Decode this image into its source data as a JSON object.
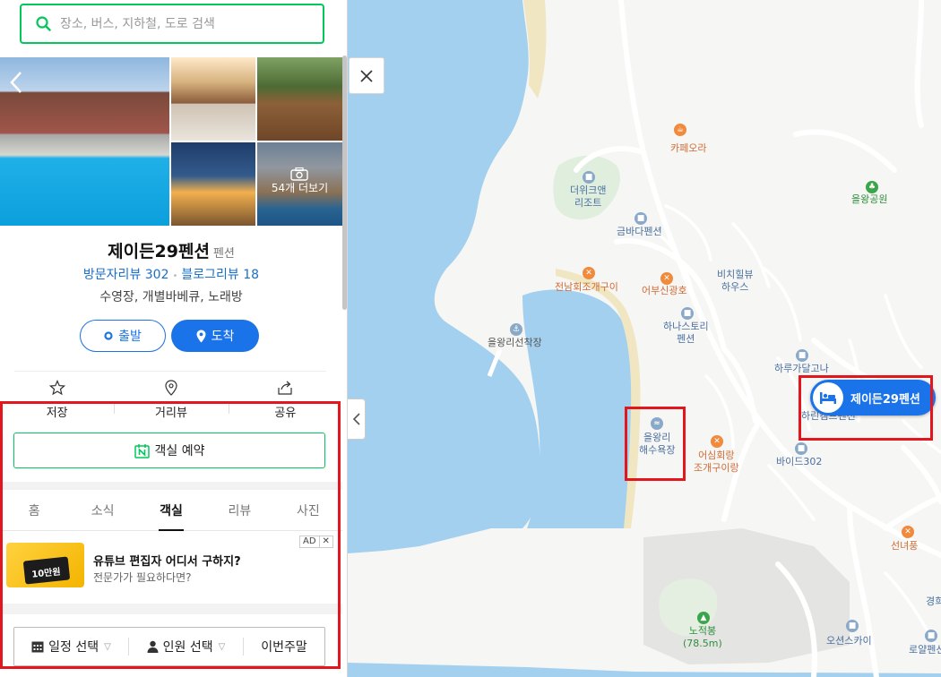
{
  "search": {
    "placeholder": "장소, 버스, 지하철, 도로 검색"
  },
  "photos": {
    "more_label": "54개 더보기"
  },
  "place": {
    "name": "제이든29펜션",
    "category": "펜션",
    "visitor_reviews": "방문자리뷰 302",
    "blog_reviews": "블로그리뷰 18",
    "amenities": "수영장, 개별바베큐, 노래방"
  },
  "buttons": {
    "depart": "출발",
    "arrive": "도착",
    "book": "객실 예약"
  },
  "actions": [
    {
      "label": "저장",
      "icon": "star-icon"
    },
    {
      "label": "거리뷰",
      "icon": "location-pin-icon"
    },
    {
      "label": "공유",
      "icon": "share-icon"
    }
  ],
  "tabs": [
    {
      "label": "홈",
      "active": false
    },
    {
      "label": "소식",
      "active": false
    },
    {
      "label": "객실",
      "active": true
    },
    {
      "label": "리뷰",
      "active": false
    },
    {
      "label": "사진",
      "active": false
    }
  ],
  "ad": {
    "badge": "AD",
    "close": "✕",
    "title": "유튜브 편집자 어디서 구하지?",
    "subtitle": "전문가가 필요하다면?",
    "thumb_text": "10만원"
  },
  "filters": {
    "date": "일정 선택",
    "people": "인원 선택",
    "weekend": "이번주말"
  },
  "map": {
    "pin_label": "제이든29펜션",
    "labels": {
      "cafe_ora": "카페오라",
      "the_wick": "더위크앤\n리조트",
      "eulwang_park": "을왕공원",
      "geumbada": "금바다펜션",
      "jeonnam": "전남회조개구이",
      "eobusin": "어부신광호",
      "bichihill": "비치힐뷰\n하우스",
      "eulwang_dock": "을왕리선착장",
      "hanastory": "하나스토리\n펜션",
      "harugadal": "하루가달고나",
      "harin": "하린캠프펜션",
      "eulwang_beach": "을왕리\n해수욕장",
      "eosim": "어심회랑\n조개구이랑",
      "baide": "바이드302",
      "sunnyeo": "선녀풍",
      "nojeokbong": "노적봉\n(78.5m)",
      "ocean_sky": "오션스카이",
      "rowal": "로얄펜션",
      "gyeong": "경희"
    }
  }
}
